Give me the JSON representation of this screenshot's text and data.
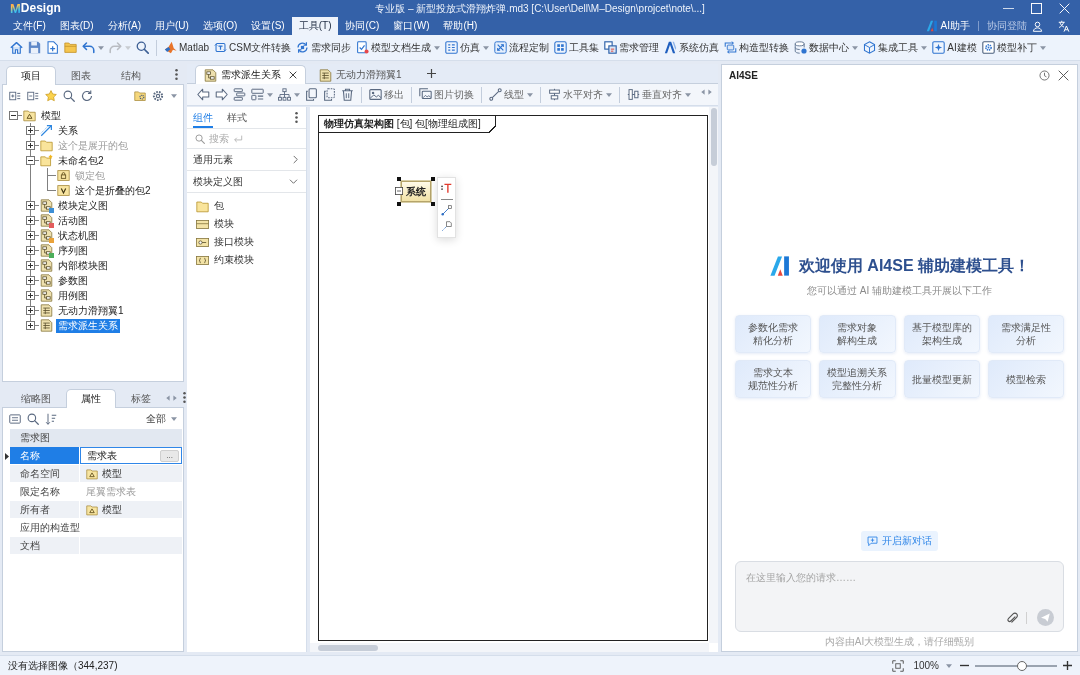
{
  "window": {
    "logo_mark": "M",
    "logo_text": "Design",
    "title": "专业版 – 新型投放式滑翔炸弹.md3 [C:\\User\\Dell\\M–Design\\projcet\\note\\...]"
  },
  "menu": [
    {
      "label": "文件(F)",
      "selected": false
    },
    {
      "label": "图表(D)",
      "selected": false
    },
    {
      "label": "分析(A)",
      "selected": false
    },
    {
      "label": "用户(U)",
      "selected": false
    },
    {
      "label": "选项(O)",
      "selected": false
    },
    {
      "label": "设置(S)",
      "selected": false
    },
    {
      "label": "工具(T)",
      "selected": true
    },
    {
      "label": "协同(C)",
      "selected": false
    },
    {
      "label": "窗口(W)",
      "selected": false
    },
    {
      "label": "帮助(H)",
      "selected": false
    }
  ],
  "menu_right": {
    "assistant": "AI助手",
    "login": "协同登陆"
  },
  "toolbar": {
    "groups": [
      [
        {
          "kind": "home",
          "menu": false,
          "disabled": false
        },
        {
          "kind": "save",
          "menu": false,
          "disabled": false
        },
        {
          "kind": "new",
          "menu": false,
          "disabled": false
        },
        {
          "kind": "open",
          "menu": false,
          "disabled": false
        },
        {
          "kind": "undo",
          "menu": true,
          "disabled": false
        },
        {
          "kind": "redo",
          "menu": true,
          "disabled": true
        },
        {
          "kind": "search",
          "menu": false,
          "disabled": false
        }
      ],
      [
        {
          "kind": "matlab",
          "label": "Matlab",
          "menu": false,
          "disabled": false
        },
        {
          "kind": "csm",
          "label": "CSM文件转换",
          "menu": false,
          "disabled": false
        },
        {
          "kind": "sync",
          "label": "需求同步",
          "menu": false,
          "disabled": false
        },
        {
          "kind": "docgen",
          "label": "模型文档生成",
          "menu": true,
          "disabled": false
        },
        {
          "kind": "sim",
          "label": "仿真",
          "menu": true,
          "disabled": false
        },
        {
          "kind": "flow",
          "label": "流程定制",
          "menu": false,
          "disabled": false
        },
        {
          "kind": "toolkit",
          "label": "工具集",
          "menu": false,
          "disabled": false
        },
        {
          "kind": "reqmgmt",
          "label": "需求管理",
          "menu": false,
          "disabled": false
        },
        {
          "kind": "syssim",
          "label": "系统仿真",
          "menu": false,
          "disabled": false
        },
        {
          "kind": "stereotype",
          "label": "构造型转换",
          "menu": false,
          "disabled": false
        },
        {
          "kind": "data",
          "label": "数据中心",
          "menu": true,
          "disabled": false
        },
        {
          "kind": "integrate",
          "label": "集成工具",
          "menu": true,
          "disabled": false
        },
        {
          "kind": "aimodel",
          "label": "AI建模",
          "menu": false,
          "disabled": false
        },
        {
          "kind": "patch",
          "label": "模型补丁",
          "menu": true,
          "disabled": false
        }
      ]
    ]
  },
  "project_panel": {
    "tabs": [
      {
        "label": "项目",
        "selected": true
      },
      {
        "label": "图表",
        "selected": false
      },
      {
        "label": "结构",
        "selected": false
      }
    ],
    "tree": [
      {
        "label": "模型",
        "kind": "model",
        "expanded": true,
        "selected": false,
        "dimmed": false,
        "children": [
          {
            "label": "关系",
            "kind": "relation",
            "expanded": false,
            "selected": false,
            "dimmed": false
          },
          {
            "label": "这个是展开的包",
            "kind": "package",
            "expanded": false,
            "selected": false,
            "dimmed": true
          },
          {
            "label": "未命名包2",
            "kind": "package-new",
            "expanded": true,
            "selected": false,
            "dimmed": false,
            "children": [
              {
                "label": "锁定包",
                "kind": "package-locked",
                "selected": false,
                "dimmed": true
              },
              {
                "label": "这个是折叠的包2",
                "kind": "package-versioned",
                "selected": false,
                "dimmed": false
              }
            ]
          },
          {
            "label": "模块定义图",
            "kind": "diagram",
            "color": "#3d8fd6",
            "expanded": false,
            "selected": false,
            "dimmed": false
          },
          {
            "label": "活动图",
            "kind": "diagram",
            "color": "#e35d5d",
            "expanded": false,
            "selected": false,
            "dimmed": false
          },
          {
            "label": "状态机图",
            "kind": "diagram",
            "color": "#e9a23a",
            "expanded": false,
            "selected": false,
            "dimmed": false
          },
          {
            "label": "序列图",
            "kind": "diagram",
            "color": "#4cae5a",
            "expanded": false,
            "selected": false,
            "dimmed": false
          },
          {
            "label": "内部模块图",
            "kind": "diagram",
            "expanded": false,
            "selected": false,
            "dimmed": false
          },
          {
            "label": "参数图",
            "kind": "diagram",
            "expanded": false,
            "selected": false,
            "dimmed": false
          },
          {
            "label": "用例图",
            "kind": "diagram",
            "expanded": false,
            "selected": false,
            "dimmed": false
          },
          {
            "label": "无动力滑翔翼1",
            "kind": "table",
            "expanded": false,
            "selected": false,
            "dimmed": false
          },
          {
            "label": "需求派生关系",
            "kind": "table",
            "expanded": false,
            "selected": true,
            "dimmed": false
          }
        ]
      }
    ]
  },
  "properties_panel": {
    "tabs": [
      {
        "label": "缩略图",
        "selected": false
      },
      {
        "label": "属性",
        "selected": true
      },
      {
        "label": "标签",
        "selected": false
      }
    ],
    "filter": "全部",
    "group": "需求图",
    "rows": [
      {
        "name": "名称",
        "kind": "field",
        "value": "需求表",
        "button": "...",
        "selected": true
      },
      {
        "name": "命名空间",
        "kind": "element",
        "value": "模型",
        "selected": false
      },
      {
        "name": "限定名称",
        "kind": "derived",
        "value": "尾翼需求表",
        "selected": false
      },
      {
        "name": "所有者",
        "kind": "element",
        "value": "模型",
        "selected": false
      },
      {
        "name": "应用的构造型",
        "kind": "text",
        "selected": false
      },
      {
        "name": "文档",
        "kind": "text",
        "selected": false
      }
    ]
  },
  "editor": {
    "tabs": [
      {
        "label": "需求派生关系",
        "kind": "diagram",
        "selected": true,
        "closable": true
      },
      {
        "label": "无动力滑翔翼1",
        "kind": "table",
        "selected": false,
        "closable": false
      }
    ],
    "toolbar": {
      "groups": [
        [
          {
            "kind": "back",
            "menu": false
          },
          {
            "kind": "forward",
            "menu": false
          },
          {
            "kind": "stack",
            "menu": false
          },
          {
            "kind": "layout",
            "menu": true
          },
          {
            "kind": "hierarchy",
            "menu": true
          },
          {
            "kind": "copy",
            "menu": false
          },
          {
            "kind": "duplicate",
            "menu": false
          },
          {
            "kind": "delete",
            "menu": false
          }
        ],
        [
          {
            "kind": "moveout",
            "label": "移出",
            "menu": false
          }
        ],
        [
          {
            "kind": "imageswap",
            "label": "图片切换",
            "menu": false
          }
        ],
        [
          {
            "kind": "linestyle",
            "label": "线型",
            "menu": true
          }
        ],
        [
          {
            "kind": "alignh",
            "label": "水平对齐",
            "menu": true
          }
        ],
        [
          {
            "kind": "alignv",
            "label": "垂直对齐",
            "menu": true
          }
        ]
      ]
    }
  },
  "palette": {
    "tabs": [
      {
        "label": "组件",
        "selected": true
      },
      {
        "label": "样式",
        "selected": false
      }
    ],
    "search": {
      "placeholder": "搜索"
    },
    "sections": [
      {
        "label": "通用元素",
        "expanded": false
      },
      {
        "label": "模块定义图",
        "expanded": true,
        "items": [
          {
            "label": "包",
            "kind": "package"
          },
          {
            "label": "模块",
            "kind": "block"
          },
          {
            "label": "接口模块",
            "kind": "interface-block"
          },
          {
            "label": "约束模块",
            "kind": "constraint-block"
          }
        ]
      }
    ]
  },
  "canvas": {
    "frame_title": "**物理仿真架构图** [包] 包[物理组成图]",
    "block": {
      "label": "系统",
      "selected": true
    }
  },
  "ai_panel": {
    "title": "AI4SE",
    "heading": "欢迎使用 AI4SE 辅助建模工具！",
    "subtitle": "您可以通过 AI 辅助建模工具开展以下工作",
    "actions": [
      {
        "lines": [
          "参数化需求",
          "精化分析"
        ]
      },
      {
        "lines": [
          "需求对象",
          "解构生成"
        ]
      },
      {
        "lines": [
          "基于模型库的",
          "架构生成"
        ]
      },
      {
        "lines": [
          "需求满足性",
          "分析"
        ]
      },
      {
        "lines": [
          "需求文本",
          "规范性分析"
        ]
      },
      {
        "lines": [
          "模型追溯关系",
          "完整性分析"
        ]
      },
      {
        "lines": [
          "批量模型更新"
        ]
      },
      {
        "lines": [
          "模型检索"
        ]
      }
    ],
    "new_chat": "开启新对话",
    "input": {
      "placeholder": "在这里输入您的请求……"
    },
    "disclaimer": "内容由AI大模型生成，请仔细甄别"
  },
  "status_bar": {
    "message": "没有选择图像（344,237)",
    "zoom": "100%",
    "zoom_slider": {
      "level": 0.57
    }
  }
}
